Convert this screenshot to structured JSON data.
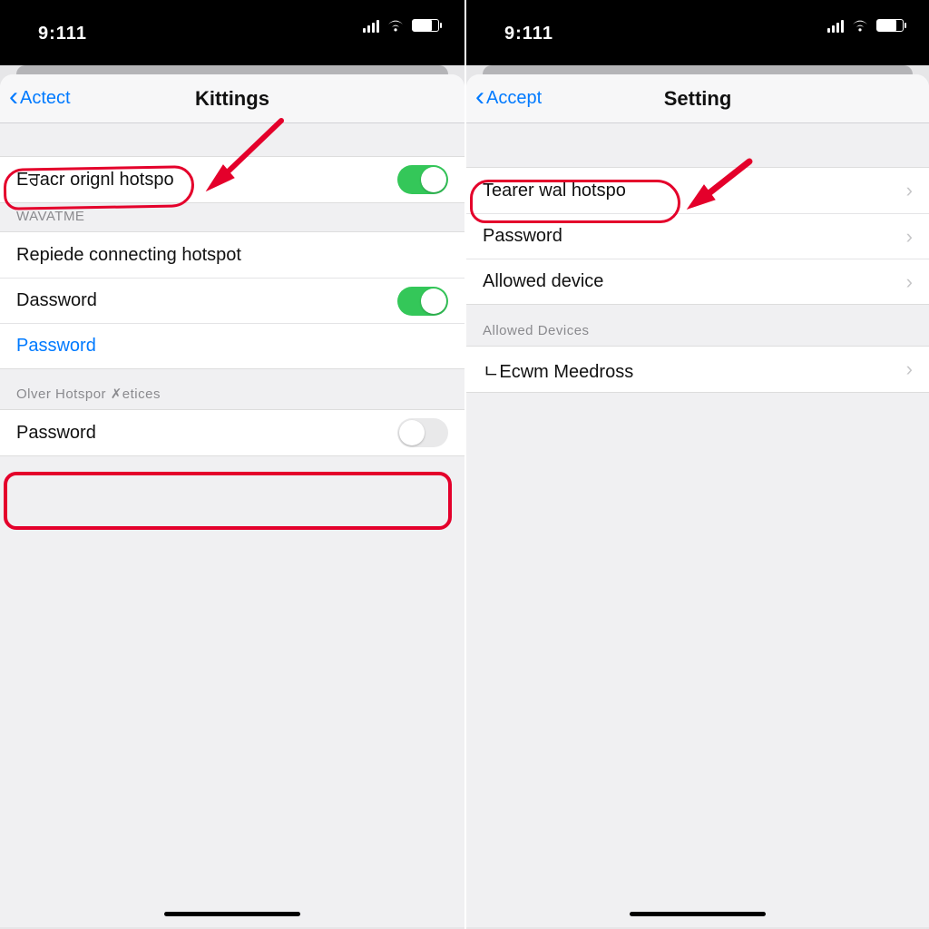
{
  "left": {
    "status": {
      "time": "9:111"
    },
    "nav": {
      "back": "Actect",
      "title": "Kittings"
    },
    "row_hotspot": "Eਰacr orignl hotspo",
    "section1_header": "WAVATME",
    "row_connecting": "Repiede connecting hotspot",
    "row_dassword": "Dassword",
    "row_password_link": "Password",
    "section2_header": "Olver Hotspor ✗etices",
    "row_password_toggle": "Password"
  },
  "right": {
    "status": {
      "time": "9:111"
    },
    "nav": {
      "back": "Accept",
      "title": "Setting"
    },
    "row_hotspot": "Tearer wal hotspo",
    "row_password": "Password",
    "row_allowed": "Allowed device",
    "section_header": "Allowed Devices",
    "row_device": "ㄴEcwm Meedross"
  }
}
